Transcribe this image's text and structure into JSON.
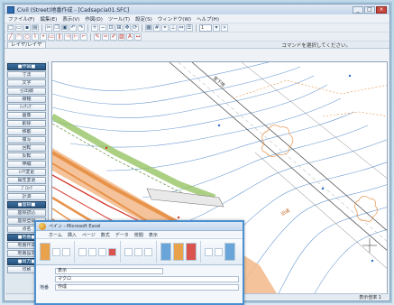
{
  "window": {
    "title": "Civil (Street)地番作成 - [Cadsapcia01.SFC]"
  },
  "menubar": {
    "items": [
      "ファイル(F)",
      "編集(E)",
      "表示(V)",
      "作図(D)",
      "ツール(T)",
      "設定(S)",
      "ウィンドウ(W)",
      "ヘルプ(H)"
    ]
  },
  "toolbar": {
    "field_value": "1"
  },
  "subbar": {
    "tab_label": "レイヤ/レイヤ",
    "hint": "コマンドを選択してください。"
  },
  "left_panel": {
    "items": [
      "■作図■",
      "寸法",
      "文字",
      "引出線",
      "線種",
      "ﾊｯﾁﾝｸﾞ",
      "画像",
      "削除",
      "移動",
      "複写",
      "回転",
      "反転",
      "伸縮",
      "ﾚｲﾔ変更",
      "属性変更",
      "ﾌﾞﾛｯｸ",
      "計測",
      "■座標■",
      "座標読込",
      "座標登録",
      "点名",
      "■地番■",
      "地番作成",
      "地番設定",
      "■出力■",
      "印刷"
    ]
  },
  "statusbar": {
    "value": "表示倍率 1"
  },
  "popup": {
    "title": "ペイン - Microsoft Excel",
    "tabs": [
      "ホーム",
      "挿入",
      "ページ",
      "数式",
      "データ",
      "校閲",
      "表示"
    ],
    "rows": [
      {
        "label": "",
        "value": "表示"
      },
      {
        "label": "",
        "value": "マクロ"
      },
      {
        "label": "地番",
        "value": "作成"
      }
    ]
  },
  "canvas_labels": {
    "topo_label": "宮下地",
    "road_label": "旧道"
  },
  "colors": {
    "accent": "#4a8fd0",
    "orange": "#e8934a",
    "green": "#8fbf5a",
    "contour": "#6b9ad1",
    "red_line": "#d63a2e"
  }
}
